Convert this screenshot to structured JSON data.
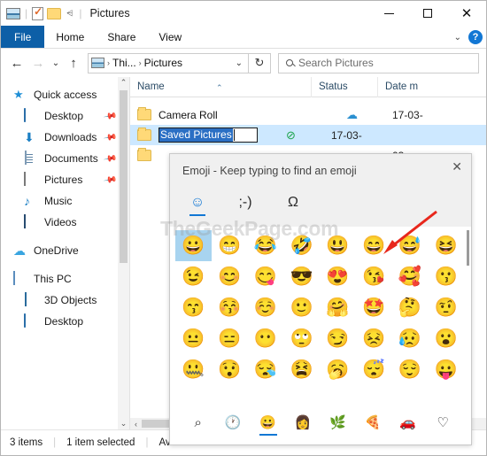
{
  "window": {
    "title": "Pictures",
    "quick_access_toolbar": [
      "picture-icon",
      "properties-icon",
      "new-folder-icon",
      "customize-dropdown"
    ],
    "controls": {
      "minimize": "–",
      "maximize": "□",
      "close": "✕"
    }
  },
  "ribbon": {
    "tabs": [
      {
        "label": "File",
        "active": true
      },
      {
        "label": "Home",
        "active": false
      },
      {
        "label": "Share",
        "active": false
      },
      {
        "label": "View",
        "active": false
      }
    ],
    "expand_label": "⌄",
    "help_label": "?"
  },
  "address_bar": {
    "back": "←",
    "forward": "→",
    "recent": "⌄",
    "up": "↑",
    "breadcrumb": [
      "Thi...",
      "Pictures"
    ],
    "breadcrumb_sep": "›",
    "dropdown": "⌄",
    "refresh": "↻"
  },
  "search": {
    "placeholder": "Search Pictures",
    "icon": "search-icon"
  },
  "sidebar": {
    "items": [
      {
        "label": "Quick access",
        "icon": "star-icon",
        "level": 1,
        "pinned": false
      },
      {
        "label": "Desktop",
        "icon": "monitor-icon",
        "level": 2,
        "pinned": true
      },
      {
        "label": "Downloads",
        "icon": "download-icon",
        "level": 2,
        "pinned": true
      },
      {
        "label": "Documents",
        "icon": "document-icon",
        "level": 2,
        "pinned": true
      },
      {
        "label": "Pictures",
        "icon": "picture-icon",
        "level": 2,
        "pinned": true
      },
      {
        "label": "Music",
        "icon": "music-icon",
        "level": 2,
        "pinned": false
      },
      {
        "label": "Videos",
        "icon": "video-icon",
        "level": 2,
        "pinned": false
      },
      {
        "label": "OneDrive",
        "icon": "cloud-icon",
        "level": 1,
        "pinned": false
      },
      {
        "label": "This PC",
        "icon": "pc-icon",
        "level": 1,
        "pinned": false
      },
      {
        "label": "3D Objects",
        "icon": "cube-icon",
        "level": 2,
        "pinned": false
      },
      {
        "label": "Desktop",
        "icon": "monitor-icon",
        "level": 2,
        "pinned": false
      }
    ],
    "scroll_up": "⌃",
    "scroll_down": "⌄"
  },
  "file_list": {
    "columns": [
      "Name",
      "Status",
      "Date m"
    ],
    "sort_indicator": "⌃",
    "rows": [
      {
        "name": "Camera Roll",
        "status_icon": "cloud-icon",
        "date": "17-03-",
        "selected": false,
        "renaming": false
      },
      {
        "name": "Saved Pictures",
        "status_icon": "check-icon",
        "date": "17-03-",
        "selected": true,
        "renaming": true
      },
      {
        "name": "",
        "status_icon": "",
        "date": "03-",
        "selected": false,
        "renaming": false
      }
    ],
    "rename_value": "Saved Pictures"
  },
  "status_bar": {
    "item_count": "3 items",
    "selection": "1 item selected",
    "availability": "Avail"
  },
  "emoji_panel": {
    "title": "Emoji - Keep typing to find an emoji",
    "close_label": "✕",
    "tabs": [
      {
        "name": "emoji-tab",
        "glyph": "☺",
        "active": true
      },
      {
        "name": "kaomoji-tab",
        "glyph": ";-)",
        "active": false
      },
      {
        "name": "symbols-tab",
        "glyph": "Ω",
        "active": false
      }
    ],
    "grid": [
      [
        "😀",
        "😁",
        "😂",
        "🤣",
        "😃",
        "😄",
        "😅",
        "😆"
      ],
      [
        "😉",
        "😊",
        "😋",
        "😎",
        "😍",
        "😘",
        "🥰",
        "😗"
      ],
      [
        "😙",
        "😚",
        "☺️",
        "🙂",
        "🤗",
        "🤩",
        "🤔",
        "🤨"
      ],
      [
        "😐",
        "😑",
        "😶",
        "🙄",
        "😏",
        "😣",
        "😥",
        "😮"
      ],
      [
        "🤐",
        "😯",
        "😪",
        "😫",
        "🥱",
        "😴",
        "😌",
        "😛"
      ]
    ],
    "selected_index": 0,
    "categories": [
      {
        "name": "search-category",
        "glyph": "⌕",
        "active": false
      },
      {
        "name": "recent-category",
        "glyph": "🕐",
        "active": false
      },
      {
        "name": "smileys-category",
        "glyph": "😀",
        "active": true
      },
      {
        "name": "people-category",
        "glyph": "👩",
        "active": false
      },
      {
        "name": "nature-category",
        "glyph": "🌿",
        "active": false
      },
      {
        "name": "food-category",
        "glyph": "🍕",
        "active": false
      },
      {
        "name": "travel-category",
        "glyph": "🚗",
        "active": false
      },
      {
        "name": "symbols-category",
        "glyph": "♡",
        "active": false
      }
    ]
  },
  "watermark": {
    "text": "TheGeekPage.com"
  },
  "annotation": {
    "arrow_color": "#e8271c"
  }
}
